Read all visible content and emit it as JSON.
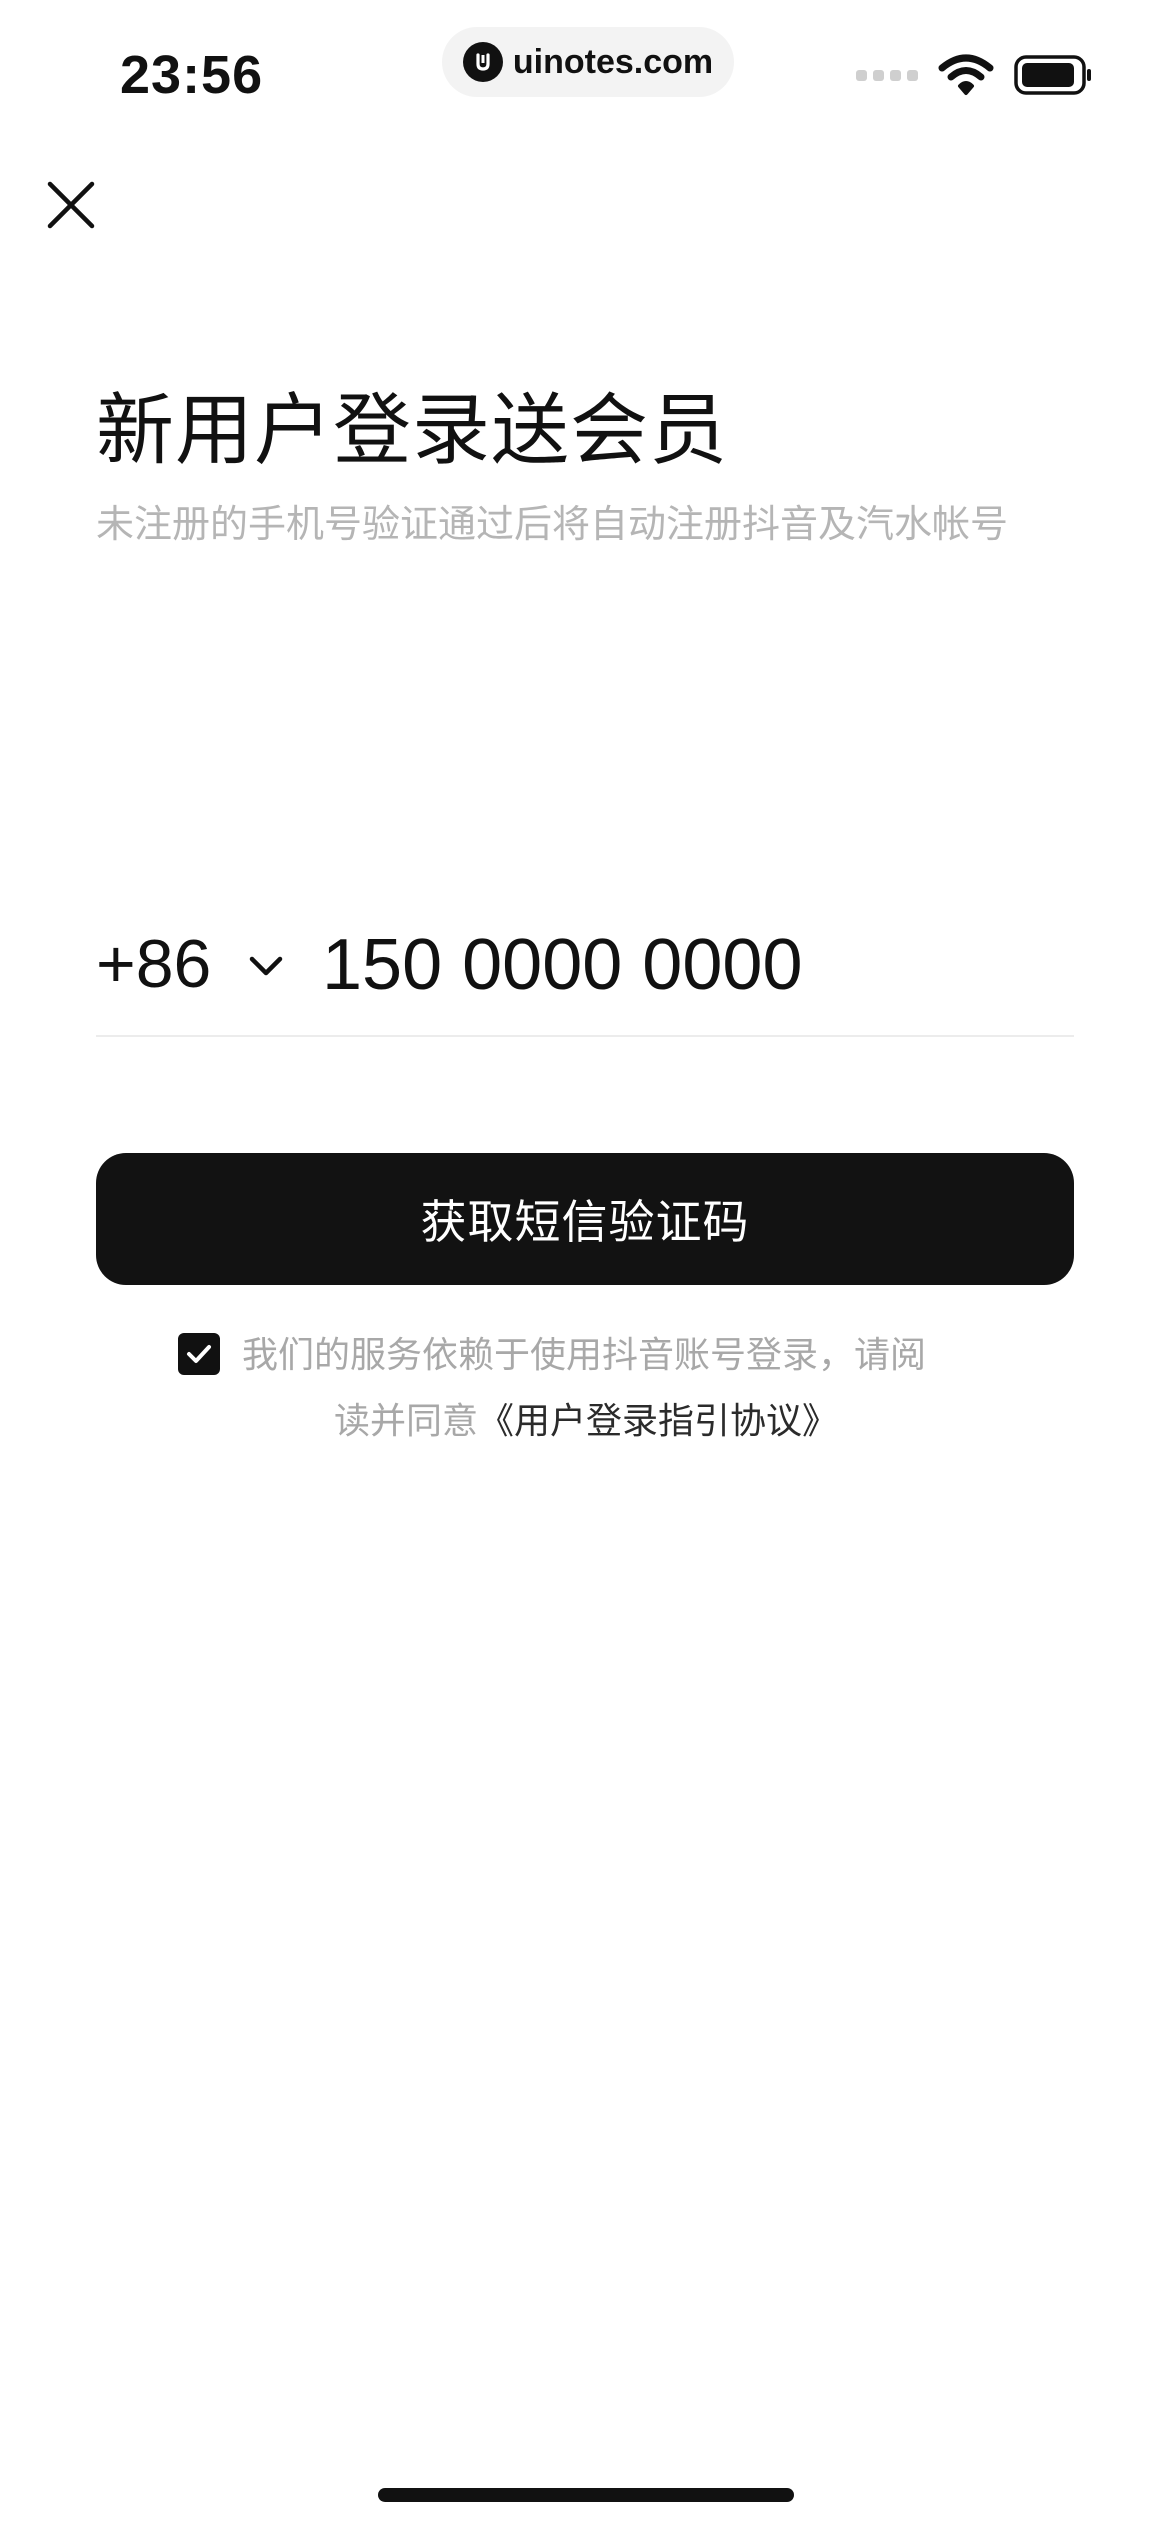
{
  "status_bar": {
    "time": "23:56",
    "site": "uinotes.com"
  },
  "header": {
    "close_icon": "close-icon",
    "title": "新用户登录送会员",
    "subtitle": "未注册的手机号验证通过后将自动注册抖音及汽水帐号"
  },
  "phone": {
    "country_code": "+86",
    "number": "150 0000 0000"
  },
  "actions": {
    "sms_button_label": "获取短信验证码"
  },
  "agreement": {
    "checked": true,
    "line1": "我们的服务依赖于使用抖音账号登录，请阅",
    "line2_prefix": "读并同意",
    "link_text": "《用户登录指引协议》"
  },
  "colors": {
    "primary": "#121212",
    "muted_text": "#b5b5b5",
    "divider": "#ececec"
  }
}
